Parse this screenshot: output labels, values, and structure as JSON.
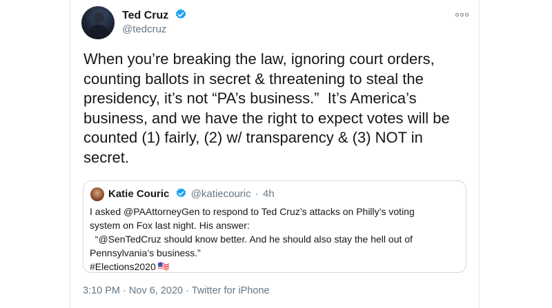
{
  "tweet": {
    "author_name": "Ted Cruz",
    "handle": "@tedcruz",
    "text": "When you’re breaking the law, ignoring court orders,\ncounting ballots in secret & threatening to steal the\npresidency, it’s not “PA’s business.”  It’s America’s\nbusiness, and we have the right to expect votes will be\ncounted (1) fairly, (2) w/ transparency & (3) NOT in\nsecret.",
    "time": "3:10 PM",
    "date": "Nov 6, 2020",
    "source": "Twitter for iPhone",
    "separator": "·"
  },
  "quote": {
    "author_name": "Katie Couric",
    "handle": "@katiecouric",
    "age": "4h",
    "separator": "·",
    "text": "I asked @PAAttorneyGen to respond to Ted Cruz’s attacks on Philly’s voting\nsystem on Fox last night. His answer:\n  “@SenTedCruz should know better. And he should also stay the hell out of\nPennsylvania’s business.”\n#Elections2020"
  },
  "icons": {
    "verified": "verified-badge-icon",
    "more": "more-options-icon",
    "flag": "us-flag-emoji-icon"
  },
  "colors": {
    "verified_blue": "#1da1f2",
    "secondary_text": "#657786",
    "border": "#cfd9de"
  }
}
